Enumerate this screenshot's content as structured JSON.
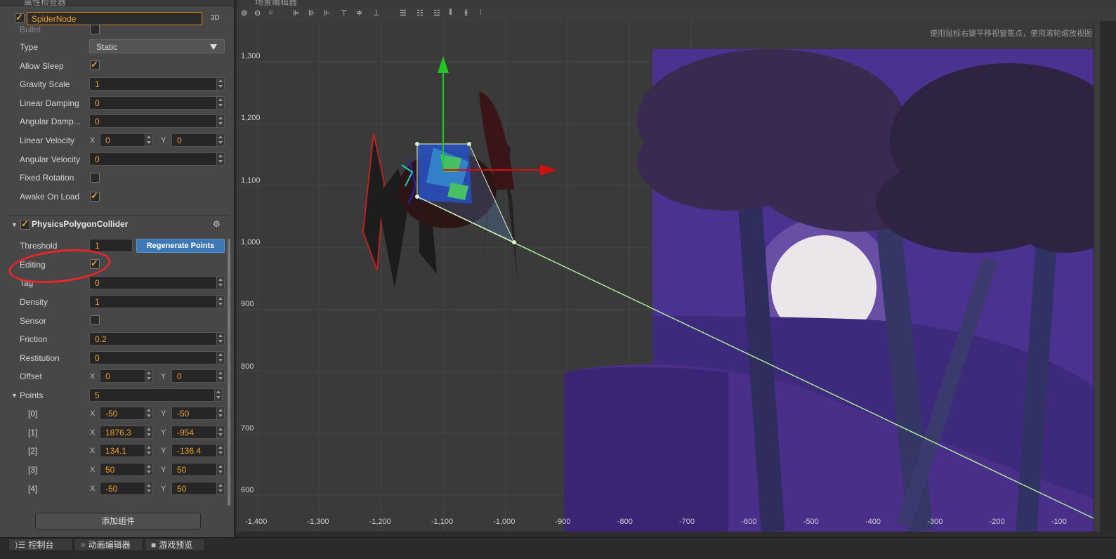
{
  "inspector": {
    "tab_title": "属性检查器",
    "node_name": "SpiderNode",
    "node_active": true,
    "btn_3d": "3D",
    "bullet_label": "Bullet",
    "type_label": "Type",
    "type_value": "Static",
    "allow_sleep_label": "Allow Sleep",
    "allow_sleep": true,
    "gravity_scale_label": "Gravity Scale",
    "gravity_scale": "1",
    "linear_damping_label": "Linear Damping",
    "linear_damping": "0",
    "angular_damping_label": "Angular Damp...",
    "angular_damping": "0",
    "linear_velocity_label": "Linear Velocity",
    "linear_velocity_x": "0",
    "linear_velocity_y": "0",
    "angular_velocity_label": "Angular Velocity",
    "angular_velocity": "0",
    "fixed_rotation_label": "Fixed Rotation",
    "fixed_rotation": false,
    "awake_on_load_label": "Awake On Load",
    "awake_on_load": true,
    "axis_x": "X",
    "axis_y": "Y",
    "collider": {
      "title": "PhysicsPolygonCollider",
      "enabled": true,
      "threshold_label": "Threshold",
      "threshold": "1",
      "regenerate_label": "Regenerate Points",
      "editing_label": "Editing",
      "editing": true,
      "tag_label": "Tag",
      "tag": "0",
      "density_label": "Density",
      "density": "1",
      "sensor_label": "Sensor",
      "sensor": false,
      "friction_label": "Friction",
      "friction": "0.2",
      "restitution_label": "Restitution",
      "restitution": "0",
      "offset_label": "Offset",
      "offset_x": "0",
      "offset_y": "0",
      "points_label": "Points",
      "points_count": "5",
      "points": [
        {
          "label": "[0]",
          "x": "-50",
          "y": "-50"
        },
        {
          "label": "[1]",
          "x": "1876.3",
          "y": "-954"
        },
        {
          "label": "[2]",
          "x": "134.1",
          "y": "-136.4"
        },
        {
          "label": "[3]",
          "x": "50",
          "y": "50"
        },
        {
          "label": "[4]",
          "x": "-50",
          "y": "50"
        }
      ]
    },
    "add_component_label": "添加组件"
  },
  "scene": {
    "tab_title": "场景编辑器",
    "hint": "使用鼠标右键平移视窗焦点，使用滚轮缩放视图",
    "y_labels": [
      "1,300",
      "1,200",
      "1,100",
      "1,000",
      "900",
      "800",
      "700",
      "600"
    ],
    "x_labels": [
      "-1,400",
      "-1,300",
      "-1,200",
      "-1,100",
      "-1,000",
      "-900",
      "-800",
      "-700",
      "-600",
      "-500",
      "-400",
      "-300",
      "-200",
      "-100"
    ]
  },
  "bottom_tabs": [
    {
      "icon": "console-icon",
      "label": "控制台"
    },
    {
      "icon": "animation-icon",
      "label": "动画编辑器"
    },
    {
      "icon": "video-icon",
      "label": "游戏预览"
    }
  ],
  "colors": {
    "accent": "#f0a030",
    "button_blue": "#3b78b5",
    "annotation_red": "#e8262b",
    "scene_sky": "#4a3290"
  }
}
